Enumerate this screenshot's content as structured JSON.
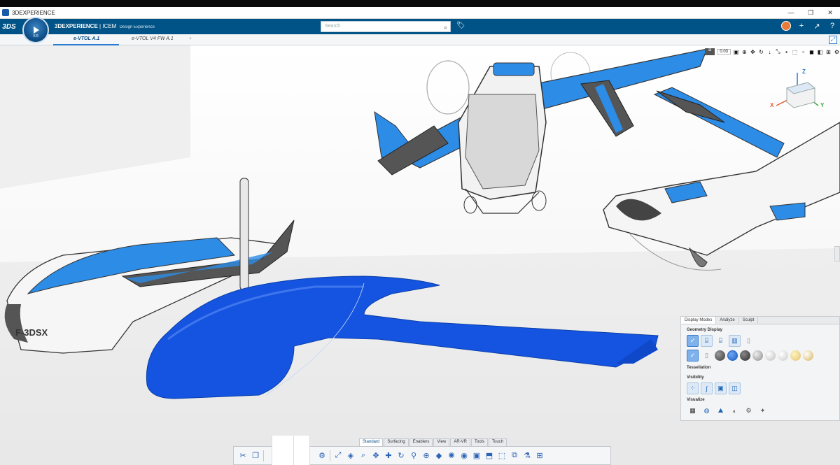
{
  "window": {
    "title": "3DEXPERIENCE",
    "controls": [
      "—",
      "❐",
      "✕"
    ]
  },
  "header": {
    "ds_logo": "3DS",
    "compass_label": "V.R",
    "brand_bold": "3DEXPERIENCE",
    "brand_rest": " | ICEM",
    "brand_sub": "Design Experience",
    "search_placeholder": "Search",
    "right_icons": [
      "+",
      "↗",
      "?"
    ]
  },
  "tabs": [
    {
      "label": "e-VTOL A.1",
      "active": true
    },
    {
      "label": "e-VTOL V4 FW A.1",
      "active": false
    }
  ],
  "viewport": {
    "zoom_value": "0.03",
    "aircraft_marking": "F-3DSX",
    "axes": {
      "x": "X",
      "y": "Y",
      "z": "Z"
    }
  },
  "panel": {
    "tabs": [
      "Display Modes",
      "Analyze",
      "Sculpt"
    ],
    "sections": {
      "geometry": "Geometry Display",
      "tessellation": "Tessellation",
      "visibility": "Visibility",
      "visualize": "Visualize"
    },
    "material_colors": [
      "#3b3b3b",
      "#2a2a2a",
      "#1f62c7",
      "#2c2c2c",
      "#8a8a8a",
      "#bdbdbd",
      "#d6d6d6",
      "#c8c8c8",
      "#e3c36a",
      "#d9b25a"
    ]
  },
  "toolbar": {
    "tabs": [
      "Standard",
      "Surfacing",
      "Enablers",
      "View",
      "AR-VR",
      "Tools",
      "Touch"
    ],
    "active_tab": "View"
  },
  "colors": {
    "brand_blue": "#005386",
    "model_blue": "#1454e0",
    "accent": "#2a7bd1"
  }
}
